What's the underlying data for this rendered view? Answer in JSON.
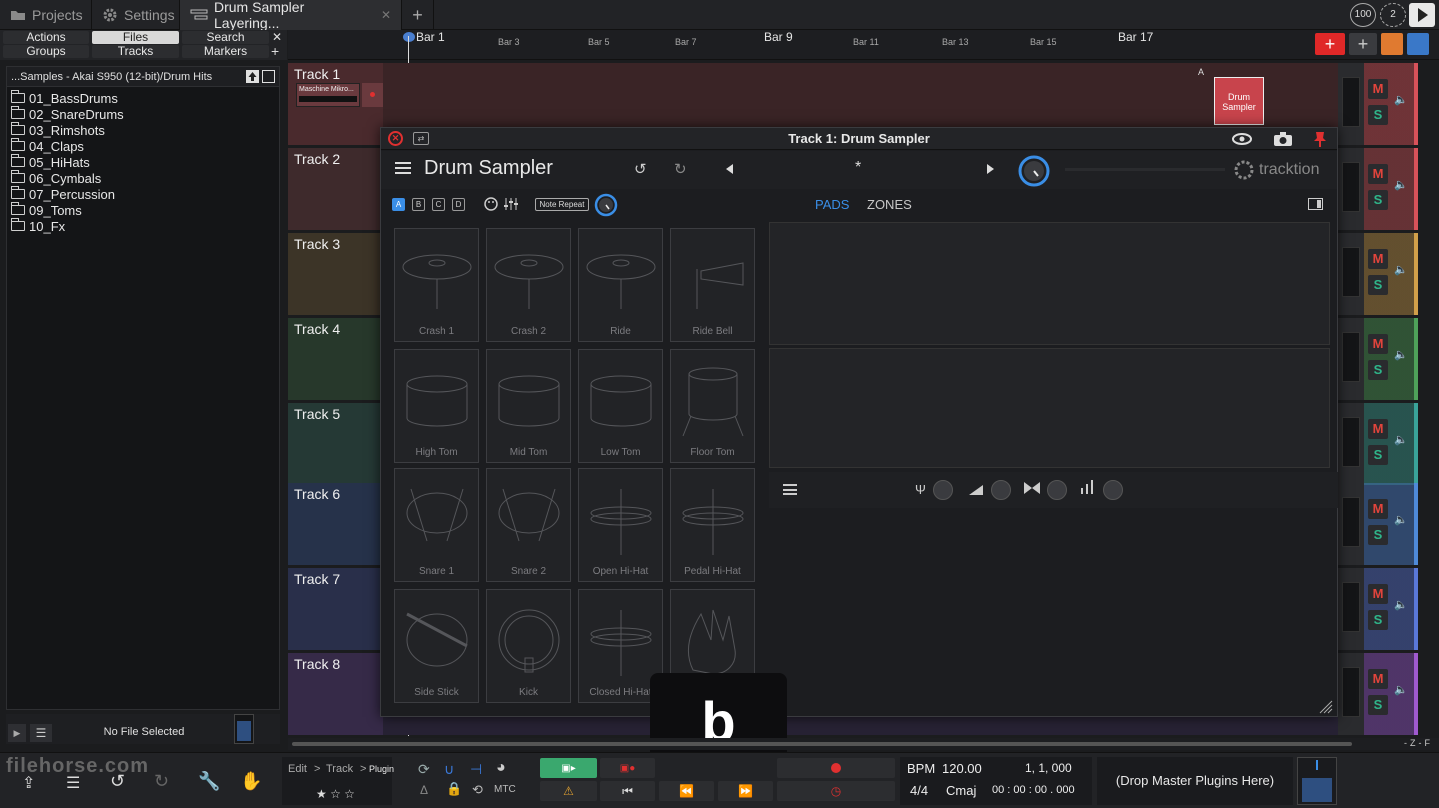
{
  "top_tabs": {
    "projects": "Projects",
    "settings": "Settings",
    "edit": "Drum Sampler Layering...",
    "cpu_meter": "100",
    "count": "2"
  },
  "left_nav": {
    "actions": "Actions",
    "files": "Files",
    "search": "Search",
    "groups": "Groups",
    "tracks": "Tracks",
    "markers": "Markers"
  },
  "browser": {
    "path": "...Samples - Akai S950 (12-bit)/Drum Hits",
    "folders": [
      "01_BassDrums",
      "02_SnareDrums",
      "03_Rimshots",
      "04_Claps",
      "05_HiHats",
      "06_Cymbals",
      "07_Percussion",
      "09_Toms",
      "10_Fx"
    ],
    "footer_status": "No File Selected"
  },
  "ruler": {
    "major": [
      "Bar 1",
      "Bar 9",
      "Bar 17"
    ],
    "minor": [
      "Bar 3",
      "Bar 5",
      "Bar 7",
      "Bar 11",
      "Bar 13",
      "Bar 15"
    ]
  },
  "tracks": [
    {
      "name": "Track 1",
      "color": "#d8525a",
      "clip": "Maschine Mikro...",
      "plugin": "Drum Sampler"
    },
    {
      "name": "Track 2",
      "color": "#d8525a"
    },
    {
      "name": "Track 3",
      "color": "#d2a04a"
    },
    {
      "name": "Track 4",
      "color": "#4fa25a"
    },
    {
      "name": "Track 5",
      "color": "#3aa49a"
    },
    {
      "name": "Track 6",
      "color": "#4f8ad8"
    },
    {
      "name": "Track 7",
      "color": "#5a78d8"
    },
    {
      "name": "Track 8",
      "color": "#a05ad0"
    }
  ],
  "mixer": {
    "mute": "M",
    "solo": "S",
    "auto_marker": "A"
  },
  "plugin": {
    "window_title": "Track 1: Drum Sampler",
    "name": "Drum Sampler",
    "preset": "*",
    "brand": "tracktion",
    "banks": [
      "A",
      "B",
      "C",
      "D"
    ],
    "note_repeat": "Note Repeat",
    "tab_pads": "PADS",
    "tab_zones": "ZONES",
    "pads": [
      "Crash 1",
      "Crash 2",
      "Ride",
      "Ride Bell",
      "High Tom",
      "Mid Tom",
      "Low Tom",
      "Floor Tom",
      "Snare 1",
      "Snare 2",
      "Open Hi-Hat",
      "Pedal Hi-Hat",
      "Side Stick",
      "Kick",
      "Closed Hi-Hat",
      "Clap"
    ]
  },
  "overlay_letter": "b",
  "watermark": "filehorse.com",
  "transport": {
    "breadcrumb_edit": "Edit",
    "breadcrumb_track": "Track",
    "breadcrumb_plugin": "Plugin",
    "mtc": "MTC",
    "bpm_label": "BPM",
    "bpm_value": "120.00",
    "position": "1, 1, 000",
    "time_sig": "4/4",
    "key": "Cmaj",
    "timecode": "00 : 00 : 00 . 000",
    "master_plugins": "(Drop Master Plugins Here)"
  },
  "colors": {
    "accent_blue": "#3a8ee6",
    "record_red": "#e03030",
    "mute_red": "#e2443c",
    "solo_teal": "#2fb58a",
    "active_green": "#3aa86e"
  }
}
